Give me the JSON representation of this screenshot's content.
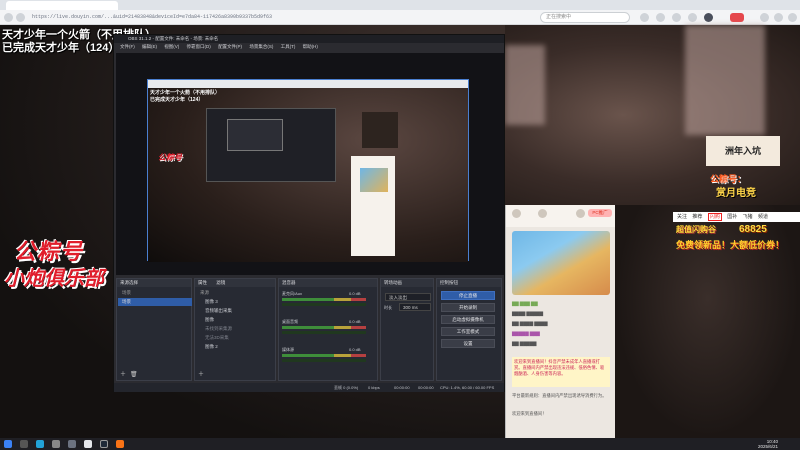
{
  "browser": {
    "url": "https://live.douyin.com/...&uid=21483848&deviceId=e7da84-117426a8390b9337b5d9f63d00071751",
    "search_placeholder": "正在搜索中"
  },
  "overlay": {
    "line1": "天才少年一个火箭（不用排队）",
    "line2": "已完成天才少年（124）",
    "logo_line1": "公粽号",
    "logo_line2": "小炮俱乐部"
  },
  "obs": {
    "title": "OBS 31.1.2 - 配置文件: 未命名 - 场景: 未命名",
    "menu": [
      "文件(F)",
      "编辑(E)",
      "视图(V)",
      "停靠窗口(D)",
      "配置文件(P)",
      "场景集合(S)",
      "工具(T)",
      "帮助(H)"
    ],
    "nested_line1": "天才少年一个火箭（不用排队）",
    "nested_line2": "已完成天才少年（124）",
    "nested_logo": "公粽号",
    "scenes_header": "场景",
    "scenes_toolbar_label": "来源选择",
    "scenes": [
      "场景"
    ],
    "sources_header": "来源",
    "sources_tabs": [
      "属性",
      "滤镜"
    ],
    "sources": [
      {
        "label": "图像 3",
        "dim": false
      },
      {
        "label": "音频输出采集",
        "dim": false
      },
      {
        "label": "图像",
        "dim": false
      },
      {
        "label": "未找到采集源",
        "dim": true
      },
      {
        "label": "无法3D采集",
        "dim": true
      },
      {
        "label": "图像 2",
        "dim": false
      }
    ],
    "mixer_header": "混音器",
    "mixer": [
      {
        "label": "麦克风/Aux",
        "db": "0.0 dB"
      },
      {
        "label": "桌面音频",
        "db": "0.0 dB"
      },
      {
        "label": "媒体源",
        "db": "0.0 dB"
      }
    ],
    "transitions_header": "转场动画",
    "transition_type": "淡入淡出",
    "transition_duration_label": "时长",
    "transition_duration": "300 ms",
    "controls_header": "控制按钮",
    "controls": [
      "停止直播",
      "开始录制",
      "启动虚拟摄像机",
      "工作室模式",
      "设置"
    ],
    "status": {
      "dropped": "丢帧 0 (0.0%)",
      "bitrate": "0 kbps",
      "live_time": "00:00:00",
      "rec_time": "00:00:00",
      "cpu_fps": "CPU: 1.4%, 60.00 / 60.00 FPS"
    }
  },
  "right": {
    "promo_title": "洲年入坑",
    "promo_sub": "公粽号：",
    "promo_sub2": "赏月电竞",
    "nav_tabs": [
      "关注",
      "推荐",
      "闪购",
      "国补",
      "飞猪",
      "频道"
    ],
    "active_tab": "闪购",
    "pc_badge": "PC推广",
    "gift_line1": "超值闪购谷",
    "gift_number": "68825",
    "gift_line2": "免费领新品！大额低价券！"
  },
  "chat": [
    "欢迎来到直播间！抖音严禁未成年人直播或打赏。直播间内严禁出现违法违规、低俗色情、吸烟酗酒、人身伤害等内容。",
    "平台最新规则：直播间内严禁出现诱导消费行为。",
    "欢迎来到直播间！"
  ],
  "taskbar": {
    "time": "10:40",
    "date": "2025/6/21"
  }
}
